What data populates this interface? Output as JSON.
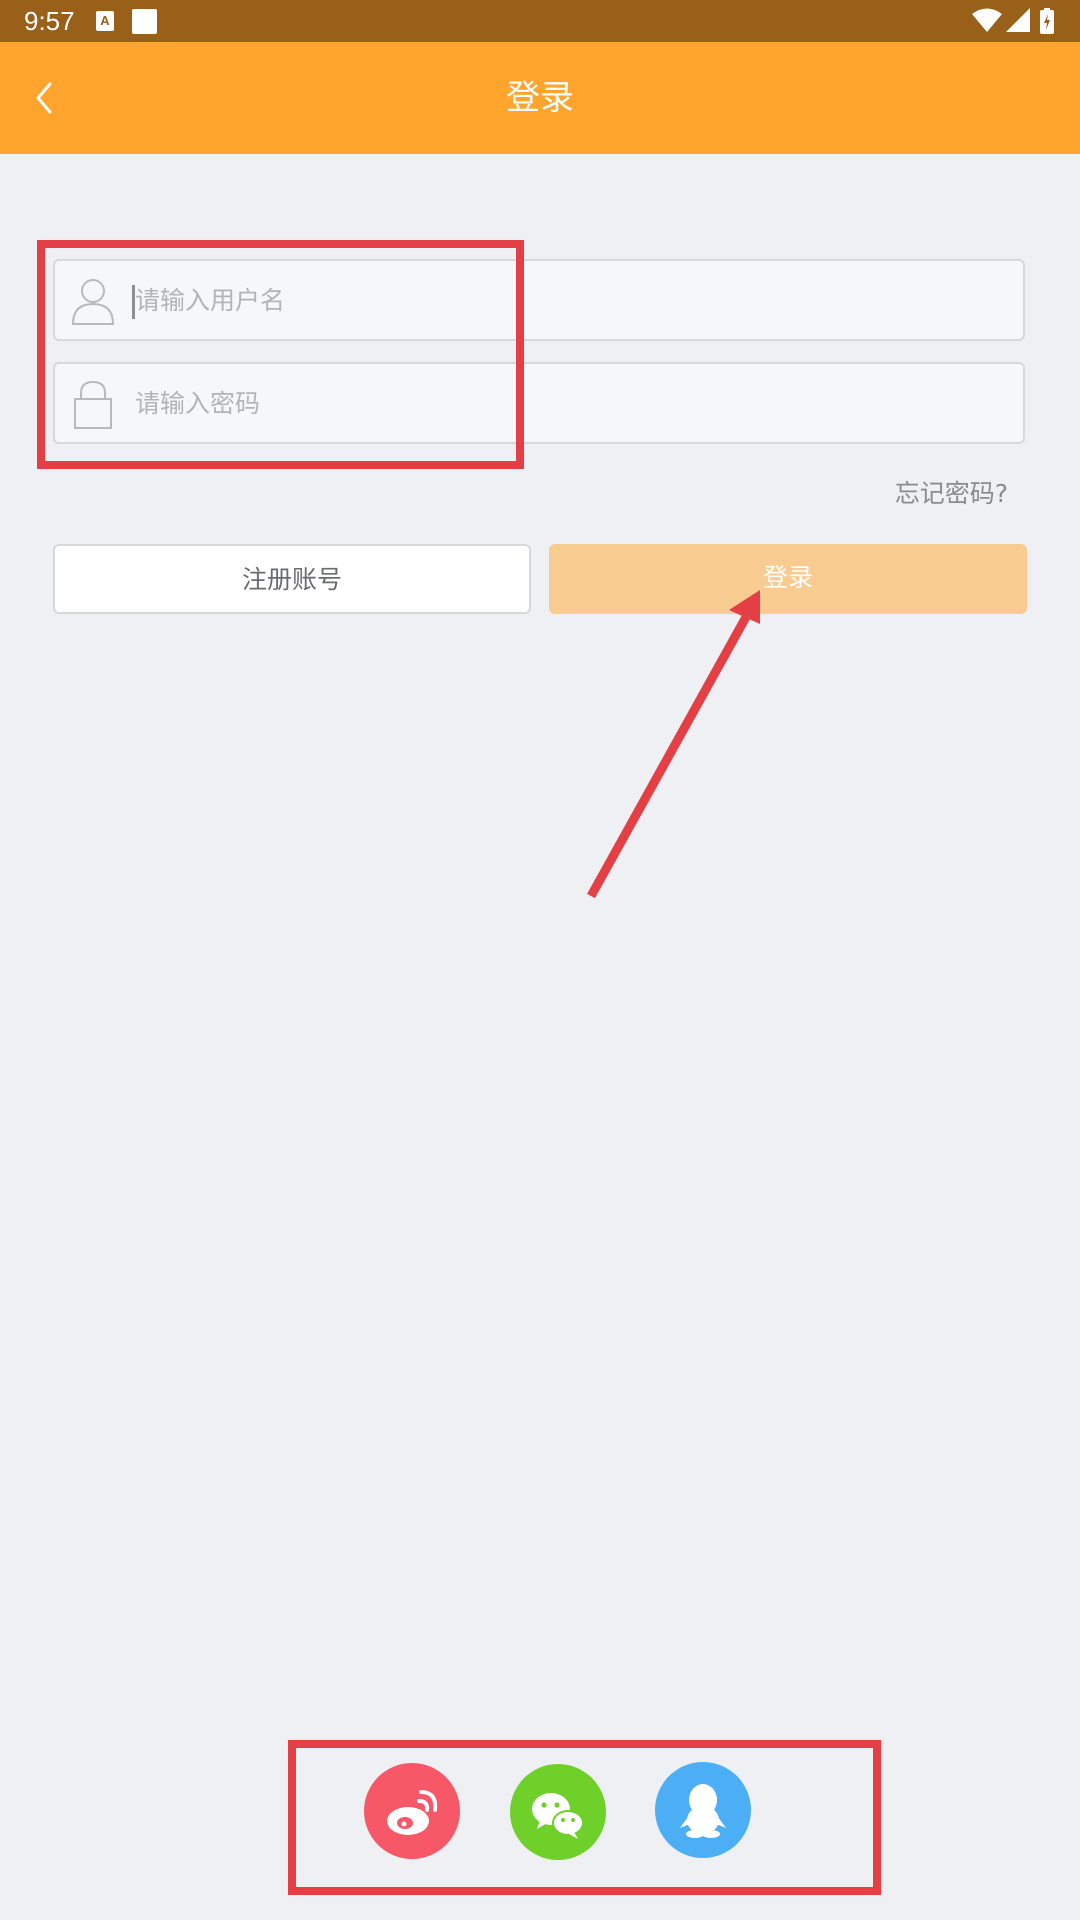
{
  "status_bar": {
    "time": "9:57",
    "notification_icon_letter": "A",
    "icons": [
      "wifi-icon",
      "signal-icon",
      "battery-charging-icon"
    ]
  },
  "nav": {
    "title": "登录",
    "back_icon": "chevron-left-icon"
  },
  "form": {
    "username": {
      "placeholder": "请输入用户名",
      "value": "",
      "icon": "user-icon"
    },
    "password": {
      "placeholder": "请输入密码",
      "value": "",
      "icon": "lock-icon"
    },
    "forgot_password": "忘记密码?"
  },
  "buttons": {
    "register": "注册账号",
    "login": "登录"
  },
  "social_login": [
    {
      "name": "weibo",
      "icon": "weibo-icon",
      "color": "#f65868"
    },
    {
      "name": "wechat",
      "icon": "wechat-icon",
      "color": "#6fd029"
    },
    {
      "name": "qq",
      "icon": "qq-penguin-icon",
      "color": "#4caff5"
    }
  ],
  "colors": {
    "status_bar": "#99601a",
    "accent": "#ffa42c",
    "login_button": "#f8cc90",
    "annotation": "#e43f44"
  }
}
